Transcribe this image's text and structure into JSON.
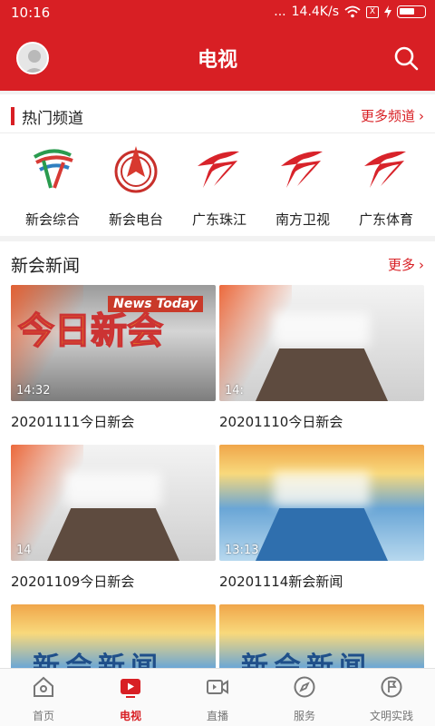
{
  "status": {
    "time": "10:16",
    "speed": "14.4K/s",
    "signal_dots": "...",
    "sim": "X"
  },
  "header": {
    "title": "电视"
  },
  "channels": {
    "title": "热门频道",
    "more": "更多频道",
    "items": [
      {
        "label": "新会综合"
      },
      {
        "label": "新会电台"
      },
      {
        "label": "广东珠江"
      },
      {
        "label": "南方卫视"
      },
      {
        "label": "广东体育"
      }
    ]
  },
  "news": {
    "title": "新会新闻",
    "more": "更多",
    "items": [
      {
        "caption": "20201111今日新会",
        "duration": "14:32",
        "overlay_cn": "今日新会",
        "overlay_en": "News Today"
      },
      {
        "caption": "20201110今日新会",
        "duration": "14:"
      },
      {
        "caption": "20201109今日新会",
        "duration": "14"
      },
      {
        "caption": "20201114新会新闻",
        "duration": "13:13"
      },
      {
        "overlay": "新会新闻"
      },
      {
        "overlay": "新会新闻"
      }
    ]
  },
  "tabs": [
    {
      "label": "首页"
    },
    {
      "label": "电视"
    },
    {
      "label": "直播"
    },
    {
      "label": "服务"
    },
    {
      "label": "文明实践"
    }
  ],
  "colors": {
    "brand_red": "#d81f24"
  }
}
